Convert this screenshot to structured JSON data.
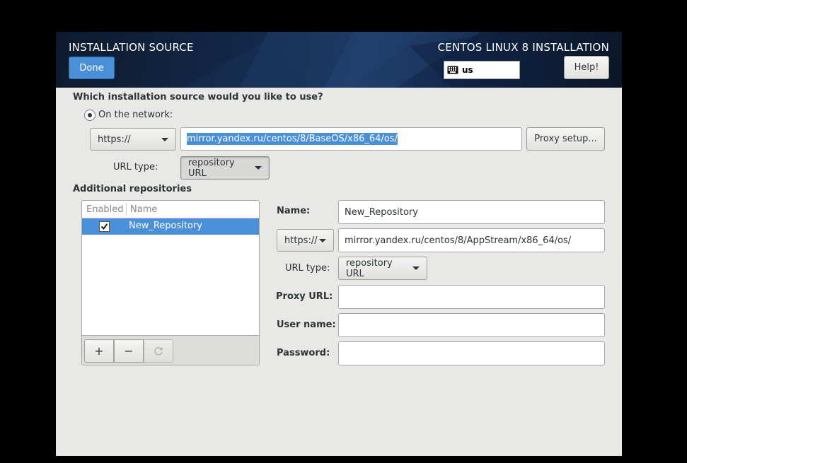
{
  "header": {
    "title": "INSTALLATION SOURCE",
    "product": "CENTOS LINUX 8 INSTALLATION",
    "done_label": "Done",
    "help_label": "Help!",
    "keyboard_layout": "us"
  },
  "source": {
    "question": "Which installation source would you like to use?",
    "network_option": "On the network:",
    "protocol": "https://",
    "url": "mirror.yandex.ru/centos/8/BaseOS/x86_64/os/",
    "proxy_button": "Proxy setup...",
    "url_type_label": "URL type:",
    "url_type": "repository URL"
  },
  "additional": {
    "heading": "Additional repositories",
    "columns": [
      "Enabled",
      "Name"
    ],
    "rows": [
      {
        "enabled": true,
        "name": "New_Repository"
      }
    ],
    "toolbar": {
      "add": "+",
      "remove": "−"
    }
  },
  "repo_form": {
    "name_label": "Name:",
    "name_value": "New_Repository",
    "protocol": "https://",
    "url": "mirror.yandex.ru/centos/8/AppStream/x86_64/os/",
    "url_type_label": "URL type:",
    "url_type": "repository URL",
    "proxy_url_label": "Proxy URL:",
    "proxy_url_value": "",
    "username_label": "User name:",
    "username_value": "",
    "password_label": "Password:",
    "password_value": ""
  },
  "colors": {
    "accent": "#4a90d9",
    "window_bg": "#e8e8e7",
    "header_bg": "#13294a"
  }
}
